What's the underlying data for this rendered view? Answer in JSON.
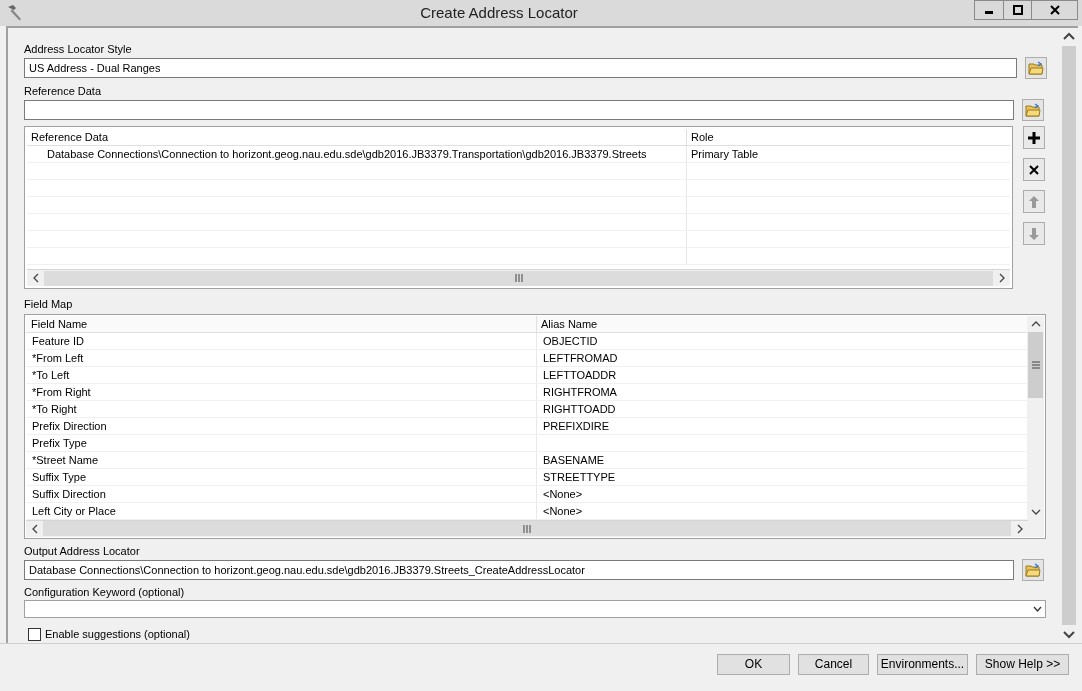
{
  "window": {
    "title": "Create Address Locator"
  },
  "address_locator_style": {
    "label": "Address Locator Style",
    "value": "US Address - Dual Ranges"
  },
  "reference_data": {
    "label": "Reference Data"
  },
  "reference_table": {
    "columns": [
      "Reference Data",
      "Role"
    ],
    "rows": [
      {
        "reference_data": "Database Connections\\Connection to horizont.geog.nau.edu.sde\\gdb2016.JB3379.Transportation\\gdb2016.JB3379.Streets",
        "role": "Primary Table"
      }
    ]
  },
  "field_map": {
    "label": "Field Map",
    "columns": [
      "Field Name",
      "Alias Name"
    ],
    "rows": [
      {
        "field_name": "Feature ID",
        "alias_name": "OBJECTID"
      },
      {
        "field_name": "*From Left",
        "alias_name": "LEFTFROMAD"
      },
      {
        "field_name": "*To Left",
        "alias_name": "LEFTTOADDR"
      },
      {
        "field_name": "*From Right",
        "alias_name": "RIGHTFROMA"
      },
      {
        "field_name": "*To Right",
        "alias_name": "RIGHTTOADD"
      },
      {
        "field_name": "Prefix Direction",
        "alias_name": "PREFIXDIRE"
      },
      {
        "field_name": "Prefix Type"
      },
      {
        "field_name": "*Street Name",
        "alias_name": "BASENAME"
      },
      {
        "field_name": "Suffix Type",
        "alias_name": "STREETTYPE"
      },
      {
        "field_name": "Suffix Direction",
        "alias_name": "<None>"
      },
      {
        "field_name": "Left City or Place",
        "alias_name": "<None>"
      }
    ]
  },
  "output_address_locator": {
    "label": "Output Address Locator",
    "value": "Database Connections\\Connection to horizont.geog.nau.edu.sde\\gdb2016.JB3379.Streets_CreateAddressLocator"
  },
  "configuration_keyword": {
    "label": "Configuration Keyword (optional)"
  },
  "enable_suggestions": {
    "label": "Enable suggestions (optional)",
    "checked": false
  },
  "buttons": [
    "OK",
    "Cancel",
    "Environments...",
    "Show Help >>"
  ]
}
